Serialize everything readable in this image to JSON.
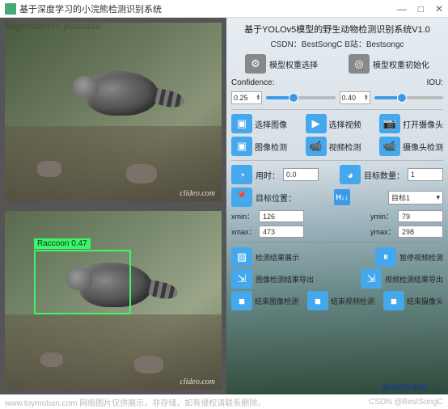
{
  "window": {
    "title": "基于深度学习的小浣熊检测识别系统",
    "watermark_top": "Reproducció pausada"
  },
  "header": {
    "title": "基于YOLOv5模型的野生动物检测识别系统V1.0",
    "subtitle": "CSDN：BestSongC    B站：Bestsongc"
  },
  "buttons": {
    "weight_select": "模型权重选择",
    "weight_init": "模型权重初始化",
    "select_image": "选择图像",
    "select_video": "选择视频",
    "open_camera": "打开摄像头",
    "image_detect": "图像检测",
    "video_detect": "视频检测",
    "camera_detect": "摄像头检测",
    "result_show": "检测结果展示",
    "pause_video": "暂停视频检测",
    "export_image": "图像检测结果导出",
    "export_video": "视频检测结果导出",
    "end_image": "结束图像检测",
    "end_video": "结束视频检测",
    "end_camera": "结束摄像头"
  },
  "labels": {
    "confidence": "Confidence:",
    "iou": "IOU:",
    "time": "用时：",
    "target_count": "目标数量：",
    "target_position": "目标位置：",
    "xmin": "xmin：",
    "ymin": "ymin：",
    "xmax": "xmax：",
    "ymax": "ymax："
  },
  "values": {
    "confidence": "0.25",
    "iou": "0.40",
    "time": "0.0",
    "target_count": "1",
    "target_select": "目标1",
    "xmin": "126",
    "ymin": "79",
    "xmax": "473",
    "ymax": "298"
  },
  "detection": {
    "label": "Raccoon  0.47"
  },
  "video": {
    "brand": "clideo.com"
  },
  "status": {
    "text": "成功打开视频！！"
  },
  "watermark_bottom": {
    "left": "www.toymoban.com  网络图片仅供展示，非存储，如有侵权请联系删除。",
    "right": "CSDN @BestSongC"
  },
  "icons": {
    "minimize": "—",
    "maximize": "□",
    "close": "✕",
    "gear": "⚙",
    "target": "◎",
    "image": "▣",
    "play": "▶",
    "camera": "📷",
    "webcam": "📹",
    "clock": "◔",
    "pie": "◕",
    "pin": "📍",
    "chart": "▨",
    "pause": "⏸",
    "export": "⇲",
    "stop": "■",
    "vcam": "▣",
    "arrow": "▾"
  }
}
